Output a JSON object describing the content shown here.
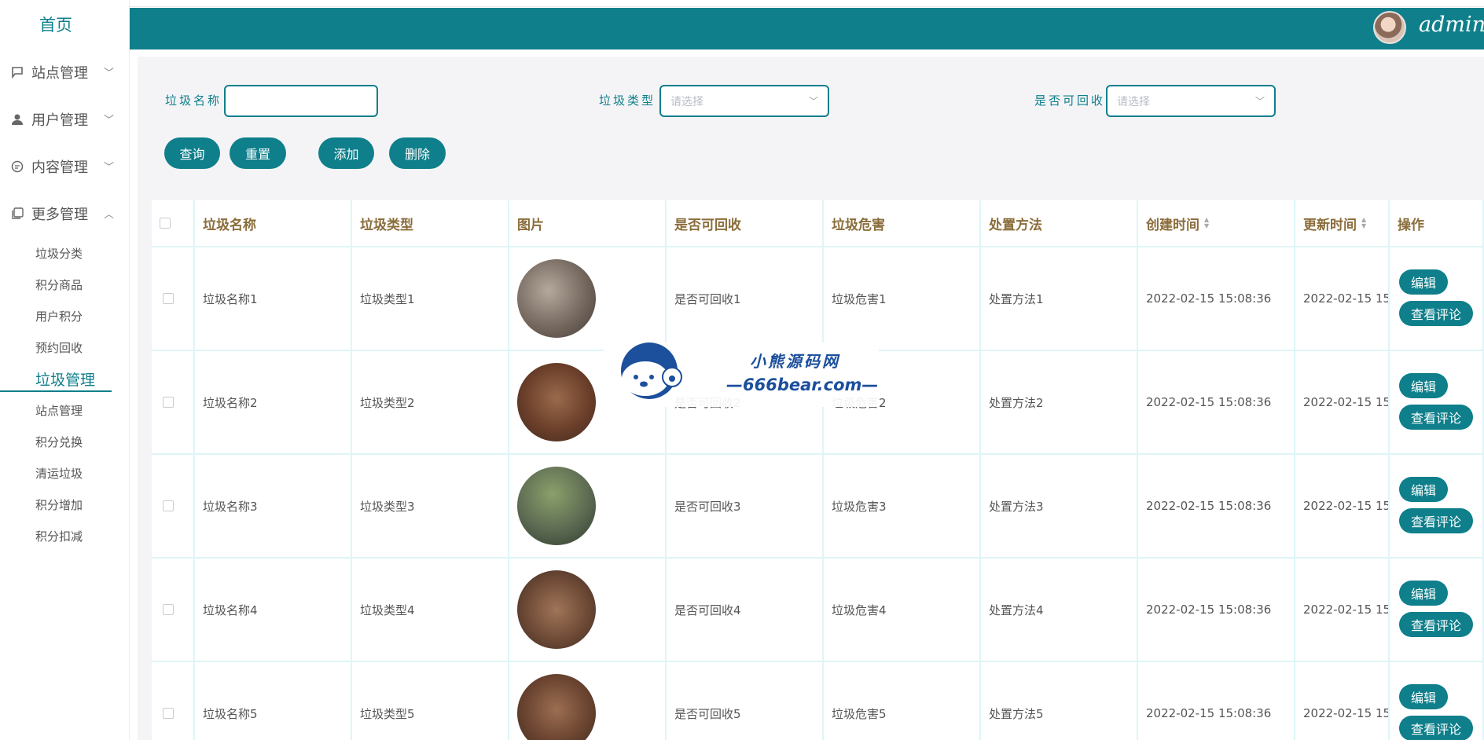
{
  "sidebar": {
    "home": "首页",
    "menus": [
      {
        "label": "站点管理",
        "icon": "flag-icon"
      },
      {
        "label": "用户管理",
        "icon": "user-icon"
      },
      {
        "label": "内容管理",
        "icon": "chat-icon"
      },
      {
        "label": "更多管理",
        "icon": "copy-icon"
      }
    ],
    "submenu": [
      "垃圾分类",
      "积分商品",
      "用户积分",
      "预约回收",
      "垃圾管理",
      "站点管理",
      "积分兑换",
      "清运垃圾",
      "积分增加",
      "积分扣减"
    ],
    "active_submenu": "垃圾管理"
  },
  "header": {
    "username": "admin",
    "bar_color": "#0e7f8b"
  },
  "filters": {
    "name_label": "垃圾名称",
    "name_value": "",
    "type_label": "垃圾类型",
    "type_placeholder": "请选择",
    "recyclable_label": "是否可回收",
    "recyclable_placeholder": "请选择"
  },
  "buttons": {
    "query": "查询",
    "reset": "重置",
    "add": "添加",
    "delete": "删除"
  },
  "table": {
    "columns": [
      "垃圾名称",
      "垃圾类型",
      "图片",
      "是否可回收",
      "垃圾危害",
      "处置方法",
      "创建时间",
      "更新时间",
      "操作"
    ],
    "rows": [
      {
        "name": "垃圾名称1",
        "type": "垃圾类型1",
        "recyclable": "是否可回收1",
        "hazard": "垃圾危害1",
        "method": "处置方法1",
        "created": "2022-02-15 15:08:36",
        "updated": "2022-02-15 15"
      },
      {
        "name": "垃圾名称2",
        "type": "垃圾类型2",
        "recyclable": "是否可回收2",
        "hazard": "垃圾危害2",
        "method": "处置方法2",
        "created": "2022-02-15 15:08:36",
        "updated": "2022-02-15 15"
      },
      {
        "name": "垃圾名称3",
        "type": "垃圾类型3",
        "recyclable": "是否可回收3",
        "hazard": "垃圾危害3",
        "method": "处置方法3",
        "created": "2022-02-15 15:08:36",
        "updated": "2022-02-15 15"
      },
      {
        "name": "垃圾名称4",
        "type": "垃圾类型4",
        "recyclable": "是否可回收4",
        "hazard": "垃圾危害4",
        "method": "处置方法4",
        "created": "2022-02-15 15:08:36",
        "updated": "2022-02-15 15"
      },
      {
        "name": "垃圾名称5",
        "type": "垃圾类型5",
        "recyclable": "是否可回收5",
        "hazard": "垃圾危害5",
        "method": "处置方法5",
        "created": "2022-02-15 15:08:36",
        "updated": "2022-02-15 15"
      }
    ],
    "actions": {
      "edit": "编辑",
      "comments": "查看评论"
    }
  },
  "watermark": {
    "cn": "小熊源码网",
    "en": "—666bear.com—"
  }
}
